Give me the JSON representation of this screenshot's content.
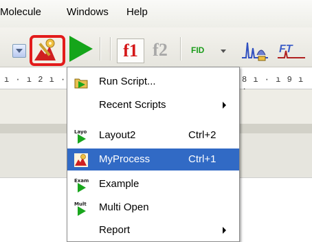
{
  "menubar": {
    "items": [
      {
        "label": "Molecule"
      },
      {
        "label": "Windows"
      },
      {
        "label": "Help"
      }
    ]
  },
  "toolbar": {
    "buttons": [
      {
        "name": "process-script-button",
        "icon": "process-script-icon",
        "highlighted": true
      },
      {
        "name": "run-button",
        "icon": "play-icon"
      },
      {
        "name": "f1-button",
        "label": "f1"
      },
      {
        "name": "f2-button",
        "label": "f2"
      },
      {
        "name": "fid-button",
        "label": "FID"
      },
      {
        "name": "spectrum-button",
        "icon": "spectrum-icon"
      },
      {
        "name": "fourier-transform-button",
        "icon": "fourier-transform-icon"
      }
    ]
  },
  "ruler": {
    "left_ticks": "ı · ı 2 ı · ı",
    "right_ticks": "8 ı · ı 9 ı ·"
  },
  "script_menu": {
    "items": [
      {
        "label": "Run Script...",
        "shortcut": "",
        "icon": "run-script-icon",
        "submenu": false
      },
      {
        "label": "Recent Scripts",
        "shortcut": "",
        "icon": "",
        "submenu": true
      },
      {
        "label": "Layout2",
        "shortcut": "Ctrl+2",
        "icon": "layout-script-icon",
        "icon_text": "Layo",
        "submenu": false
      },
      {
        "label": "MyProcess",
        "shortcut": "Ctrl+1",
        "icon": "process-script-icon",
        "submenu": false,
        "selected": true
      },
      {
        "label": "Example",
        "shortcut": "",
        "icon": "example-script-icon",
        "icon_text": "Exam",
        "submenu": false
      },
      {
        "label": "Multi Open",
        "shortcut": "",
        "icon": "multi-open-icon",
        "icon_text": "Mult",
        "submenu": false
      },
      {
        "label": "Report",
        "shortcut": "",
        "icon": "",
        "submenu": true
      }
    ]
  },
  "colors": {
    "highlight_box": "#e31b1b",
    "menu_selection": "#316ac5",
    "play_green": "#15a51a",
    "f1_red": "#d41717"
  }
}
